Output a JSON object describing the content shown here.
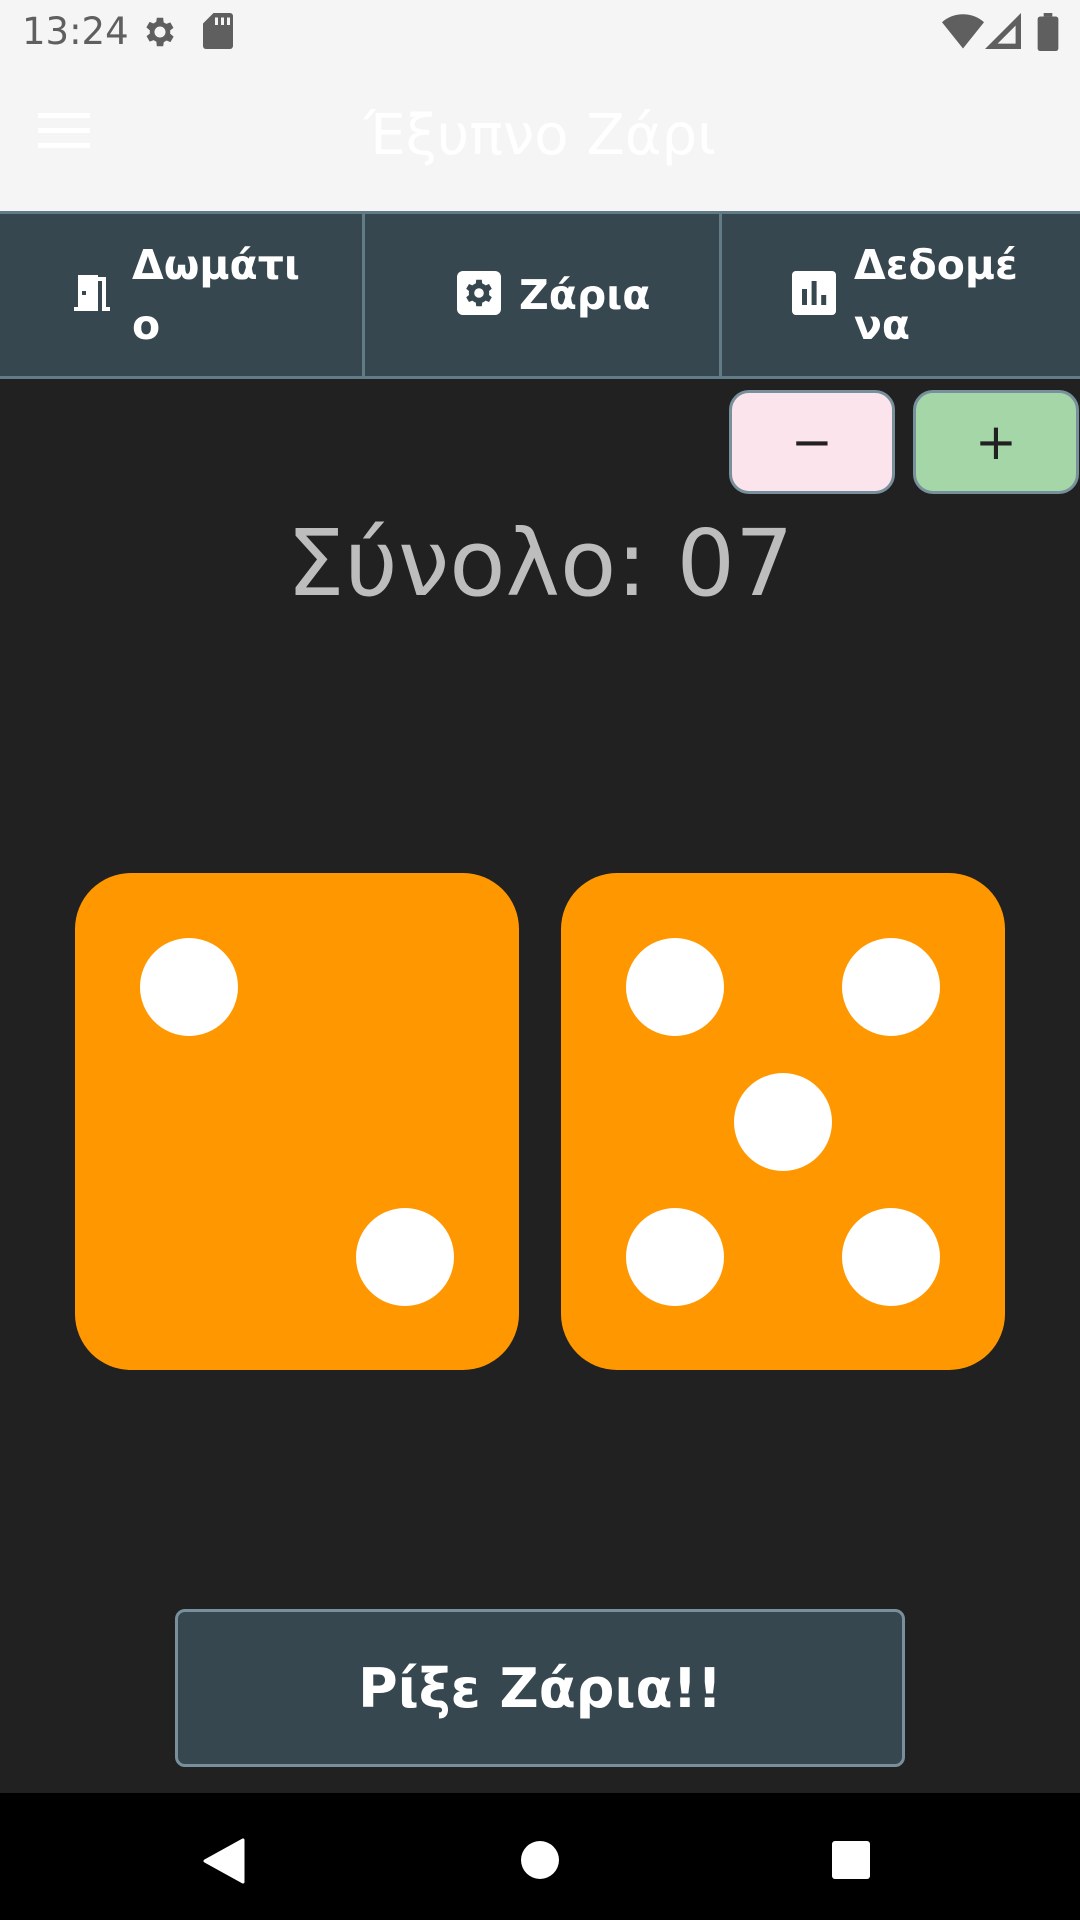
{
  "status_bar": {
    "time": "13:24",
    "icons": [
      "settings-icon",
      "sd-card-icon",
      "wifi-icon",
      "signal-icon",
      "battery-icon"
    ]
  },
  "app_bar": {
    "title": "Έξυπνο Ζάρι",
    "menu_icon": "hamburger-menu-icon"
  },
  "tabs": [
    {
      "label": "Δωμάτι\nο",
      "icon": "door-icon"
    },
    {
      "label": "Ζάρια",
      "icon": "dice-settings-icon"
    },
    {
      "label": "Δεδομέ\nνα",
      "icon": "bar-chart-icon"
    }
  ],
  "counter": {
    "minus_label": "−",
    "plus_label": "+"
  },
  "total_label": "Σύνολο: 07",
  "dice": [
    {
      "value": 2
    },
    {
      "value": 5
    }
  ],
  "roll_button_label": "Ρίξε Ζάρια!!",
  "nav_bar": {
    "icons": [
      "back-icon",
      "home-icon",
      "recents-icon"
    ]
  },
  "colors": {
    "background": "#212121",
    "die": "#ff9800",
    "tab_bar": "#37474f",
    "minus_button": "#fce4ec",
    "plus_button": "#a5d6a7"
  }
}
